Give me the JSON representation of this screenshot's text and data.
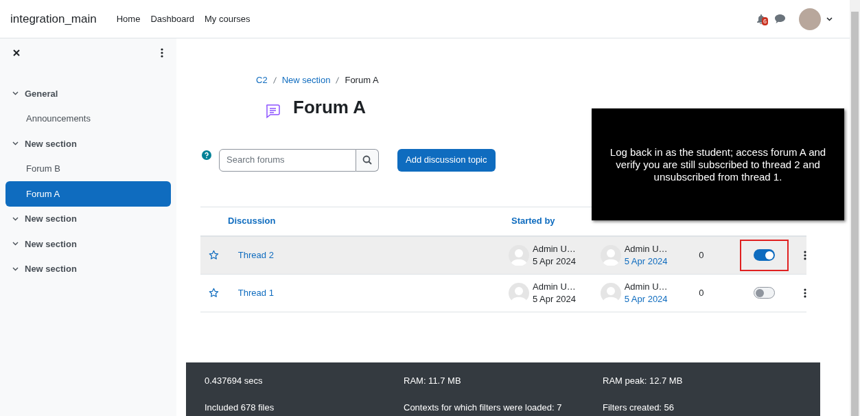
{
  "navbar": {
    "site_name": "integration_main",
    "links": [
      "Home",
      "Dashboard",
      "My courses"
    ],
    "notification_count": "6"
  },
  "sidebar": {
    "items": [
      {
        "kind": "section",
        "label": "General",
        "expanded": true,
        "selected": false
      },
      {
        "kind": "activity",
        "label": "Announcements",
        "selected": false
      },
      {
        "kind": "section",
        "label": "New section",
        "expanded": true,
        "selected": false
      },
      {
        "kind": "activity",
        "label": "Forum B",
        "selected": false
      },
      {
        "kind": "activity",
        "label": "Forum A",
        "selected": true
      },
      {
        "kind": "section",
        "label": "New section",
        "expanded": true,
        "selected": false
      },
      {
        "kind": "section",
        "label": "New section",
        "expanded": true,
        "selected": false
      },
      {
        "kind": "section",
        "label": "New section",
        "expanded": true,
        "selected": false
      }
    ]
  },
  "breadcrumb": [
    "C2",
    "New section",
    "Forum A"
  ],
  "page_title": "Forum A",
  "search": {
    "placeholder": "Search forums"
  },
  "add_button": "Add discussion topic",
  "table": {
    "columns": [
      "Discussion",
      "Started by"
    ],
    "rows": [
      {
        "title": "Thread 2",
        "starter": "Admin U…",
        "started": "5 Apr 2024",
        "last_poster": "Admin U…",
        "last_post": "5 Apr 2024",
        "replies": "0",
        "subscribed": true,
        "highlighted": true
      },
      {
        "title": "Thread 1",
        "starter": "Admin U…",
        "started": "5 Apr 2024",
        "last_poster": "Admin U…",
        "last_post": "5 Apr 2024",
        "replies": "0",
        "subscribed": false,
        "highlighted": false
      }
    ]
  },
  "instruction_overlay": "Log back in as the student; access forum A and verify you are still subscribed to thread 2 and unsubscribed from thread 1.",
  "footer": [
    [
      "0.437694 secs",
      "RAM: 11.7 MB",
      "RAM peak: 12.7 MB"
    ],
    [
      "Included 678 files",
      "Contexts for which filters were loaded: 7",
      "Filters created: 56"
    ]
  ]
}
